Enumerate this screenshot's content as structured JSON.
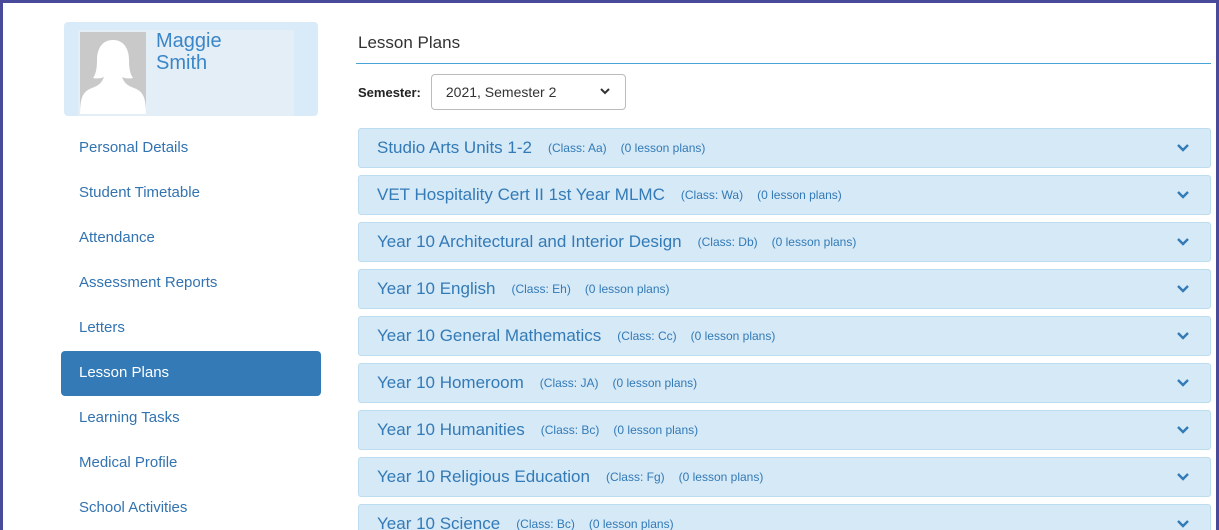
{
  "profile": {
    "first_name": "Maggie",
    "last_name": "Smith"
  },
  "nav": {
    "items": [
      {
        "label": "Personal Details",
        "active": false
      },
      {
        "label": "Student Timetable",
        "active": false
      },
      {
        "label": "Attendance",
        "active": false
      },
      {
        "label": "Assessment Reports",
        "active": false
      },
      {
        "label": "Letters",
        "active": false
      },
      {
        "label": "Lesson Plans",
        "active": true
      },
      {
        "label": "Learning Tasks",
        "active": false
      },
      {
        "label": "Medical Profile",
        "active": false
      },
      {
        "label": "School Activities",
        "active": false
      }
    ]
  },
  "main": {
    "title": "Lesson Plans",
    "semester_label": "Semester:",
    "semester_value": "2021, Semester 2"
  },
  "panels": [
    {
      "title": "Studio Arts Units 1-2",
      "class": "(Class: Aa)",
      "count": "(0 lesson plans)"
    },
    {
      "title": "VET Hospitality Cert II 1st Year MLMC",
      "class": "(Class: Wa)",
      "count": "(0 lesson plans)"
    },
    {
      "title": "Year 10 Architectural and Interior Design",
      "class": "(Class: Db)",
      "count": "(0 lesson plans)"
    },
    {
      "title": "Year 10 English",
      "class": "(Class: Eh)",
      "count": "(0 lesson plans)"
    },
    {
      "title": "Year 10 General Mathematics",
      "class": "(Class: Cc)",
      "count": "(0 lesson plans)"
    },
    {
      "title": "Year 10 Homeroom",
      "class": "(Class: JA)",
      "count": "(0 lesson plans)"
    },
    {
      "title": "Year 10 Humanities",
      "class": "(Class: Bc)",
      "count": "(0 lesson plans)"
    },
    {
      "title": "Year 10 Religious Education",
      "class": "(Class: Fg)",
      "count": "(0 lesson plans)"
    },
    {
      "title": "Year 10 Science",
      "class": "(Class: Bc)",
      "count": "(0 lesson plans)"
    }
  ],
  "colors": {
    "accent": "#337ab7",
    "panel_bg": "#d5e9f6",
    "profile_bg": "#d9ebf8",
    "frame": "#4a4a9a"
  },
  "icons": {
    "avatar": "user-silhouette-icon",
    "expand": "chevron-down-icon",
    "select": "chevron-down-icon"
  }
}
